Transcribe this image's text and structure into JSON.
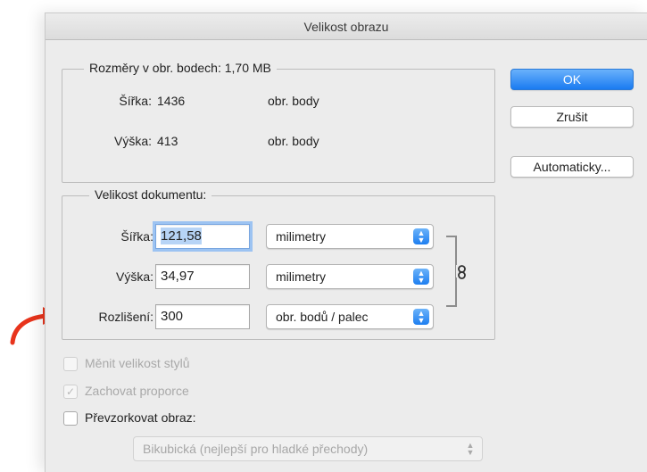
{
  "window": {
    "title": "Velikost obrazu"
  },
  "pixel_dimensions": {
    "legend": "Rozměry v obr. bodech: 1,70 MB",
    "width_label": "Šířka:",
    "width_value": "1436",
    "width_unit": "obr. body",
    "height_label": "Výška:",
    "height_value": "413",
    "height_unit": "obr. body"
  },
  "document_size": {
    "legend": "Velikost dokumentu:",
    "width_label": "Šířka:",
    "width_value": "121,58",
    "width_unit": "milimetry",
    "height_label": "Výška:",
    "height_value": "34,97",
    "height_unit": "milimetry",
    "resolution_label": "Rozlišení:",
    "resolution_value": "300",
    "resolution_unit": "obr. bodů / palec"
  },
  "buttons": {
    "ok": "OK",
    "cancel": "Zrušit",
    "auto": "Automaticky..."
  },
  "options": {
    "scale_styles": "Měnit velikost stylů",
    "constrain": "Zachovat proporce",
    "resample": "Převzorkovat obraz:",
    "resample_method": "Bikubická (nejlepší pro hladké přechody)"
  },
  "colors": {
    "accent": "#1a7bf1",
    "annotation_arrow": "#e8341c"
  }
}
